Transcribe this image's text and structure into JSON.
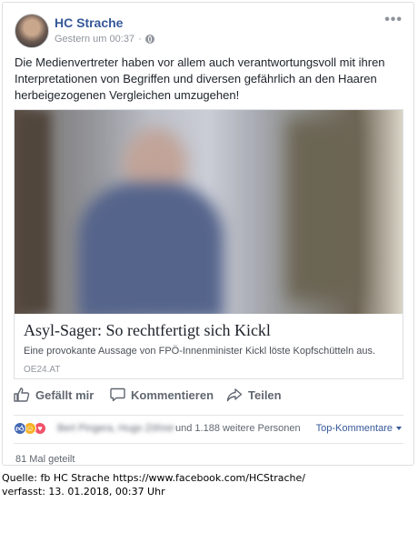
{
  "post": {
    "author": "HC Strache",
    "timestamp": "Gestern um 00:37",
    "separator": "·",
    "more_label": "•••",
    "text": "Die Medienvertreter haben vor allem auch verantwortungsvoll mit ihren Interpretationen von Begriffen und diversen gefährlich an den Haaren herbeigezogenen Vergleichen umzugehen!"
  },
  "link_preview": {
    "title": "Asyl-Sager: So rechtfertigt sich Kickl",
    "description": "Eine provokante Aussage von FPÖ-Innenminister Kickl löste Kopfschütteln aus.",
    "domain": "OE24.AT"
  },
  "actions": {
    "like": "Gefällt mir",
    "comment": "Kommentieren",
    "share": "Teilen"
  },
  "reactions": {
    "names": "Bert Pingera, Hugo Zöhrer",
    "others": "und 1.188 weitere Personen",
    "sort_label": "Top-Kommentare"
  },
  "shares": "81 Mal geteilt",
  "source": {
    "line1": "Quelle: fb HC Strache  https://www.facebook.com/HCStrache/",
    "line2": "verfasst:  13. 01.2018, 00:37 Uhr"
  },
  "colors": {
    "link_blue": "#365899",
    "like_blue": "#4267b2",
    "haha_yellow": "#f7b125",
    "love_red": "#f25268"
  },
  "icons": [
    "avatar",
    "globe-icon",
    "more-icon",
    "like-thumb-icon",
    "comment-icon",
    "share-icon",
    "like-reaction-icon",
    "haha-reaction-icon",
    "love-reaction-icon",
    "caret-down-icon"
  ]
}
